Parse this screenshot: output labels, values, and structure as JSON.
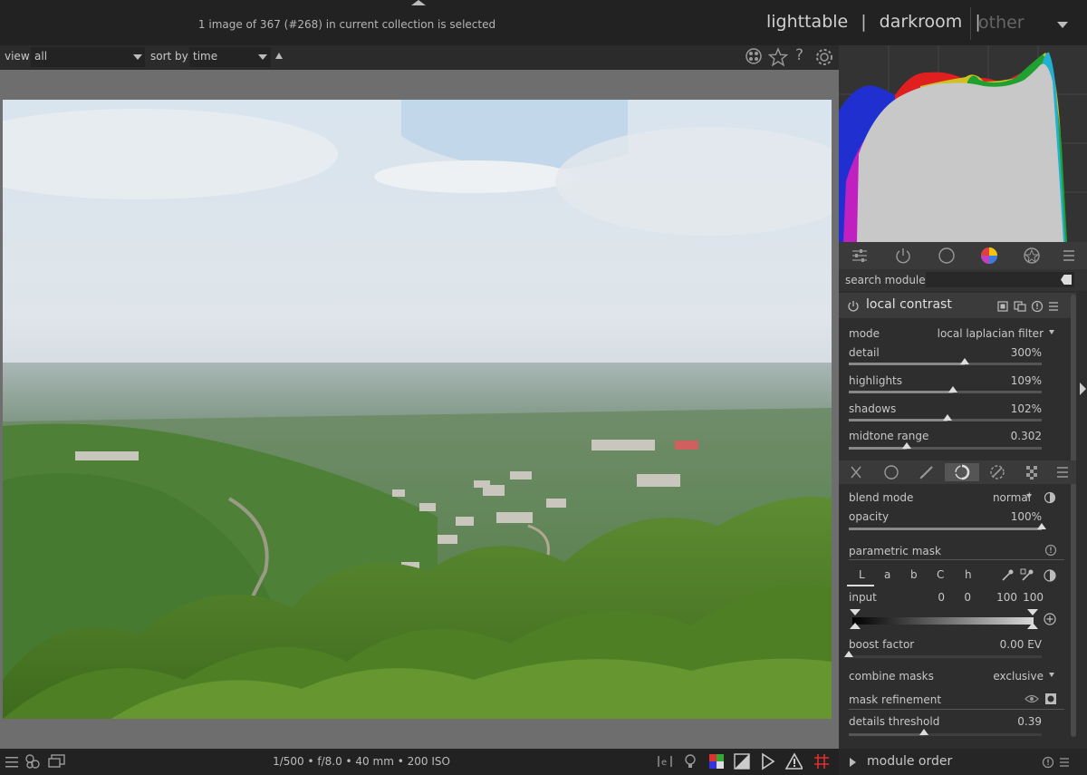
{
  "header": {
    "selection_info": "1 image of 367 (#268) in current collection is selected",
    "views": {
      "lighttable": "lighttable",
      "darkroom": "darkroom",
      "separator": "|",
      "other": "other"
    }
  },
  "filterbar": {
    "view_label": "view",
    "view_value": "all",
    "sort_label": "sort by",
    "sort_value": "time"
  },
  "footer": {
    "exif": "1/500 • f/8.0 • 40 mm • 200 ISO"
  },
  "right_panel": {
    "search_label": "search module",
    "module": {
      "name": "local contrast",
      "params": [
        {
          "label": "mode",
          "value": "local laplacian filter"
        },
        {
          "label": "detail",
          "value": "300%",
          "level": 0.6
        },
        {
          "label": "highlights",
          "value": "109%",
          "level": 0.54
        },
        {
          "label": "shadows",
          "value": "102%",
          "level": 0.51
        },
        {
          "label": "midtone range",
          "value": "0.302",
          "level": 0.3
        }
      ]
    },
    "blend": {
      "blend_mode_label": "blend mode",
      "blend_mode_value": "normal",
      "opacity_label": "opacity",
      "opacity_value": "100%",
      "opacity_level": 1.0,
      "parametric_mask_label": "parametric mask",
      "channels": [
        "L",
        "a",
        "b",
        "C",
        "h"
      ],
      "input_label": "input",
      "input_values": [
        "0",
        "0",
        "100",
        "100"
      ],
      "boost_label": "boost factor",
      "boost_value": "0.00 EV",
      "combine_label": "combine masks",
      "combine_value": "exclusive",
      "refinement_label": "mask refinement",
      "details_label": "details threshold",
      "details_value": "0.39",
      "details_level": 0.39
    },
    "module_order": "module order"
  },
  "colors": {
    "panel_bg": "#2e2e2e",
    "header_bg": "#222222",
    "image_bg": "#6e6e6e",
    "accent_red": "#e03030"
  }
}
